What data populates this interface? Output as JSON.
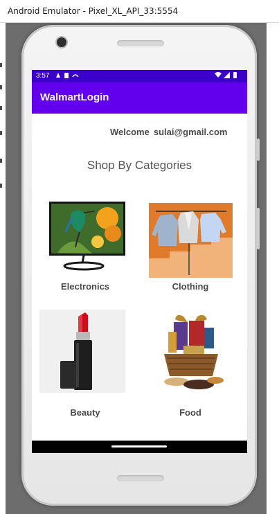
{
  "window": {
    "title": "Android Emulator - Pixel_XL_API_33:5554"
  },
  "status_bar": {
    "time": "3:57"
  },
  "app_bar": {
    "title": "WalmartLogin"
  },
  "welcome": {
    "prefix": "Welcome",
    "email": "sulai@gmail.com"
  },
  "heading": "Shop By Categories",
  "categories": [
    {
      "label": "Electronics",
      "icon": "monitor-hummingbird-image"
    },
    {
      "label": "Clothing",
      "icon": "sweaters-on-rack-image"
    },
    {
      "label": "Beauty",
      "icon": "lipstick-image"
    },
    {
      "label": "Food",
      "icon": "gift-basket-image"
    }
  ],
  "colors": {
    "status_bar": "#3a00c9",
    "app_bar": "#6200ee",
    "text": "#4a4a4a"
  }
}
